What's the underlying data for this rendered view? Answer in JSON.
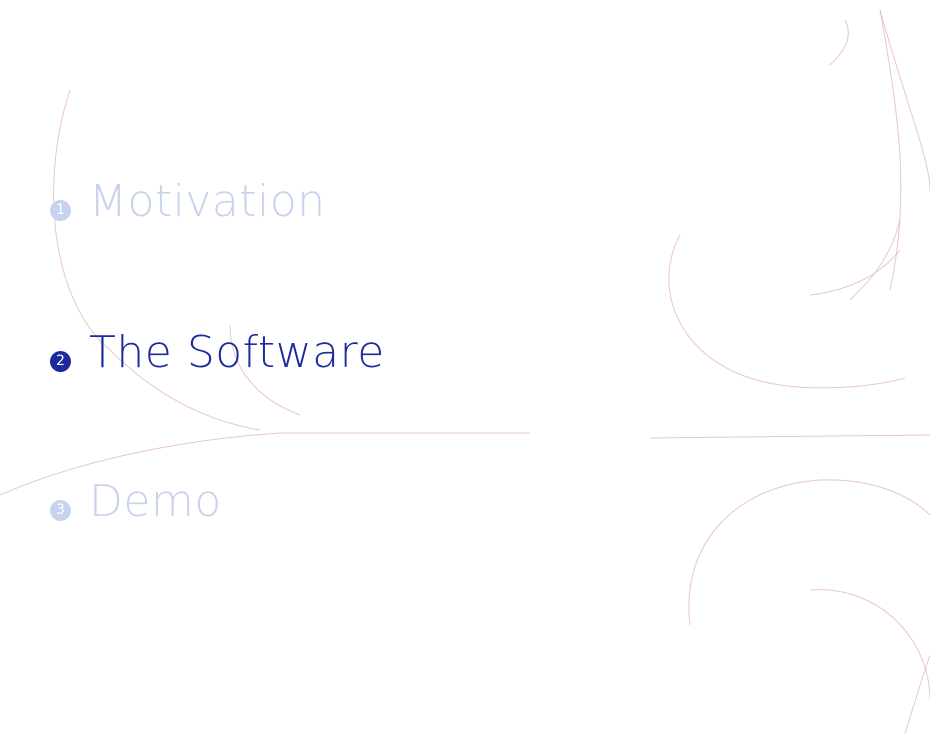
{
  "colors": {
    "active": "#1c2a9e",
    "inactive": "#c7d2ef",
    "decoration": "#e2b3b3",
    "background": "#ffffff"
  },
  "toc": {
    "items": [
      {
        "number": "1",
        "label": "Motivation",
        "state": "inactive"
      },
      {
        "number": "2",
        "label": "The Software",
        "state": "active"
      },
      {
        "number": "3",
        "label": "Demo",
        "state": "inactive"
      }
    ]
  }
}
